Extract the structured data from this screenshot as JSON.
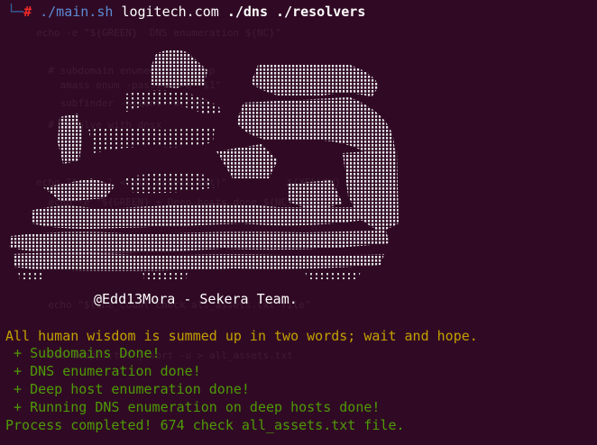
{
  "terminal": {
    "prompt": {
      "tree": "└─",
      "hash": "#",
      "script": "./main.sh",
      "domain": "logitech.com",
      "args": "./dns ./resolvers"
    },
    "credit": "@Edd13Mora - Sekera Team.",
    "quote": "All human wisdom is summed up in two words; wait and hope.",
    "steps": [
      " + Subdomains Done!",
      " + DNS enumeration done!",
      " + Deep host enumeration done!",
      " + Running DNS enumeration on deep hosts done!"
    ],
    "final": "Process completed! 674 check all_assets.txt file."
  },
  "colors": {
    "background": "#300a24",
    "prompt_tree": "#3465a4",
    "prompt_hash": "#ef2929",
    "quote": "#c4a000",
    "success": "#4e9a06",
    "text": "#ffffff"
  }
}
